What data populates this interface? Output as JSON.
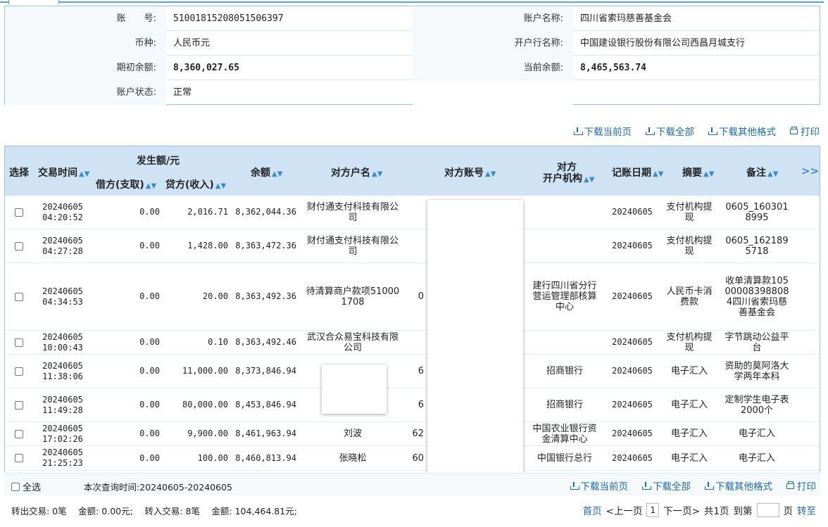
{
  "account": {
    "rows": [
      {
        "l1": "账　　号:",
        "v1": "51001815208051506397",
        "l2": "账户名称:",
        "v2": "四川省索玛慈善基金会"
      },
      {
        "l1": "币种:",
        "v1": "人民币元",
        "l2": "开户行名称:",
        "v2": "中国建设银行股份有限公司西昌月城支行"
      },
      {
        "l1": "期初余额:",
        "v1": "8,360,027.65",
        "l2": "当前余额:",
        "v2": "8,465,563.74"
      },
      {
        "l1": "账户状态:",
        "v1": "正常",
        "l2": "",
        "v2": ""
      }
    ]
  },
  "actions": {
    "download_page": "下载当前页",
    "download_all": "下载全部",
    "download_other": "下载其他格式",
    "print": "打印"
  },
  "table": {
    "headers": {
      "select": "选择",
      "time": "交易时间",
      "amount_group": "发生额/元",
      "debit": "借方(支取)",
      "credit": "贷方(收入)",
      "balance": "余额",
      "cp_name": "对方户名",
      "cp_account": "对方账号",
      "cp_bank_line1": "对方",
      "cp_bank_line2": "开户机构",
      "book_date": "记账日期",
      "summary": "摘要",
      "remark": "备注",
      "more": ">>"
    },
    "rows": [
      {
        "date": "20240605",
        "time": "04:20:52",
        "debit": "0.00",
        "credit": "2,016.71",
        "balance": "8,362,044.36",
        "cp_name": "财付通支付科技有限公司",
        "cp_account": "",
        "cp_bank": "",
        "book_date": "20240605",
        "summary": "支付机构提现",
        "remark": "0605_1603018995"
      },
      {
        "date": "20240605",
        "time": "04:27:28",
        "debit": "0.00",
        "credit": "1,428.00",
        "balance": "8,363,472.36",
        "cp_name": "财付通支付科技有限公司",
        "cp_account": "",
        "cp_bank": "",
        "book_date": "20240605",
        "summary": "支付机构提现",
        "remark": "0605_1621895718"
      },
      {
        "date": "20240605",
        "time": "04:34:53",
        "debit": "0.00",
        "credit": "20.00",
        "balance": "8,363,492.36",
        "cp_name": "待清算商户款项510001708",
        "cp_account": "0",
        "cp_bank": "建行四川省分行营运管理部核算中心",
        "book_date": "20240605",
        "summary": "人民币卡消费款",
        "remark": "收单清算款10500008398808 4四川省索玛慈善基金会"
      },
      {
        "date": "20240605",
        "time": "10:00:43",
        "debit": "0.00",
        "credit": "0.10",
        "balance": "8,363,492.46",
        "cp_name": "武汉合众易宝科技有限公司",
        "cp_account": "",
        "cp_bank": "",
        "book_date": "20240605",
        "summary": "支付机构提现",
        "remark": "字节跳动公益平台"
      },
      {
        "date": "20240605",
        "time": "11:38:06",
        "debit": "0.00",
        "credit": "11,000.00",
        "balance": "8,373,846.94",
        "cp_name": "",
        "cp_account": "6",
        "cp_bank": "招商银行",
        "book_date": "20240605",
        "summary": "电子汇入",
        "remark": "资助的莫阿洛大学两年本科"
      },
      {
        "date": "20240605",
        "time": "11:49:28",
        "debit": "0.00",
        "credit": "80,000.00",
        "balance": "8,453,846.94",
        "cp_name": "",
        "cp_account": "6",
        "cp_bank": "招商银行",
        "book_date": "20240605",
        "summary": "电子汇入",
        "remark": "定制学生电子表2000个"
      },
      {
        "date": "20240605",
        "time": "17:02:26",
        "debit": "0.00",
        "credit": "9,900.00",
        "balance": "8,461,963.94",
        "cp_name": "刘波",
        "cp_account": "62",
        "cp_bank": "中国农业银行资金清算中心",
        "book_date": "20240605",
        "summary": "电子汇入",
        "remark": "电子汇入"
      },
      {
        "date": "20240605",
        "time": "21:25:23",
        "debit": "0.00",
        "credit": "100.00",
        "balance": "8,460,813.94",
        "cp_name": "张晓松",
        "cp_account": "60",
        "cp_bank": "中国银行总行",
        "book_date": "20240605",
        "summary": "电子汇入",
        "remark": "电子汇入"
      }
    ]
  },
  "footer": {
    "select_all": "全选",
    "query_range": "本次查询时间:20240605-20240605",
    "summary": "转出交易: 0笔　 金额: 0.00元;　 转入交易: 8笔　 金额: 104,464.81元;",
    "first": "首页",
    "prev": "<上一页",
    "page": "1",
    "next": "下一页>",
    "total": "共1页",
    "goto": "到第",
    "page_unit": "页",
    "go": "转至"
  }
}
